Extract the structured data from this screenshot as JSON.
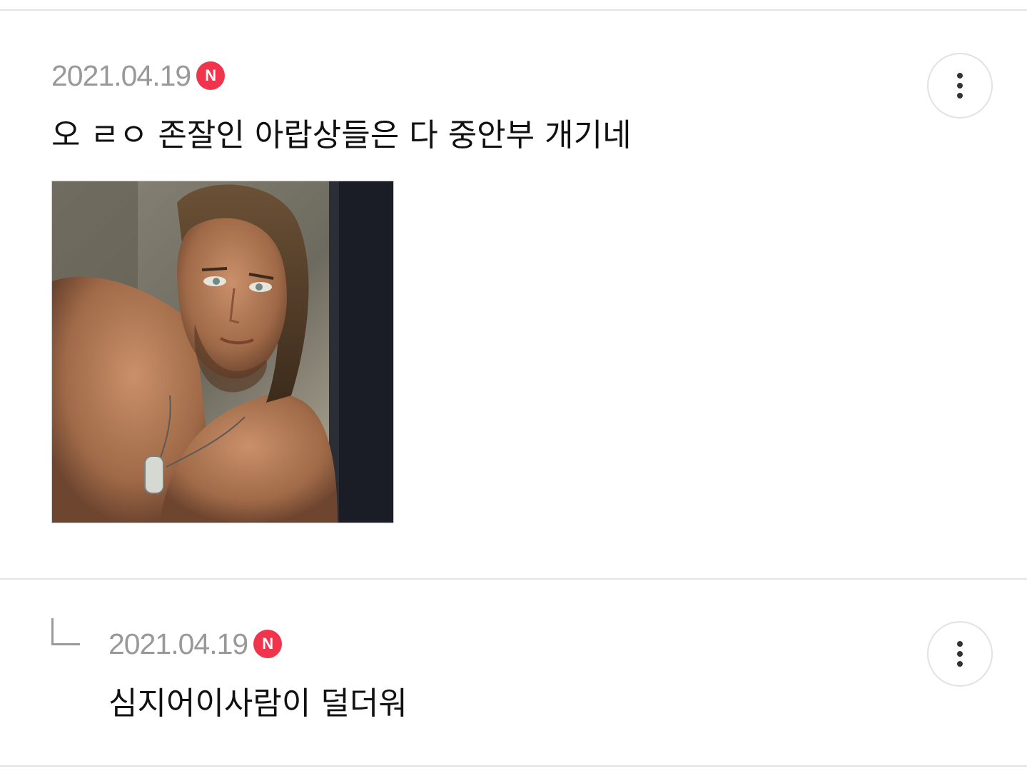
{
  "comments": [
    {
      "date": "2021.04.19",
      "badge": "N",
      "text": "오 ㄹㅇ 존잘인 아랍상들은 다 중안부 개기네",
      "has_image": true,
      "menu_icon": "more-vertical-icon"
    }
  ],
  "replies": [
    {
      "date": "2021.04.19",
      "badge": "N",
      "text": "심지어이사람이 덜더워",
      "reply_icon": "reply-corner-icon",
      "menu_icon": "more-vertical-icon"
    }
  ],
  "colors": {
    "badge": "#f0344c",
    "date": "#999999",
    "text": "#111111",
    "divider": "#e4e4e4"
  }
}
